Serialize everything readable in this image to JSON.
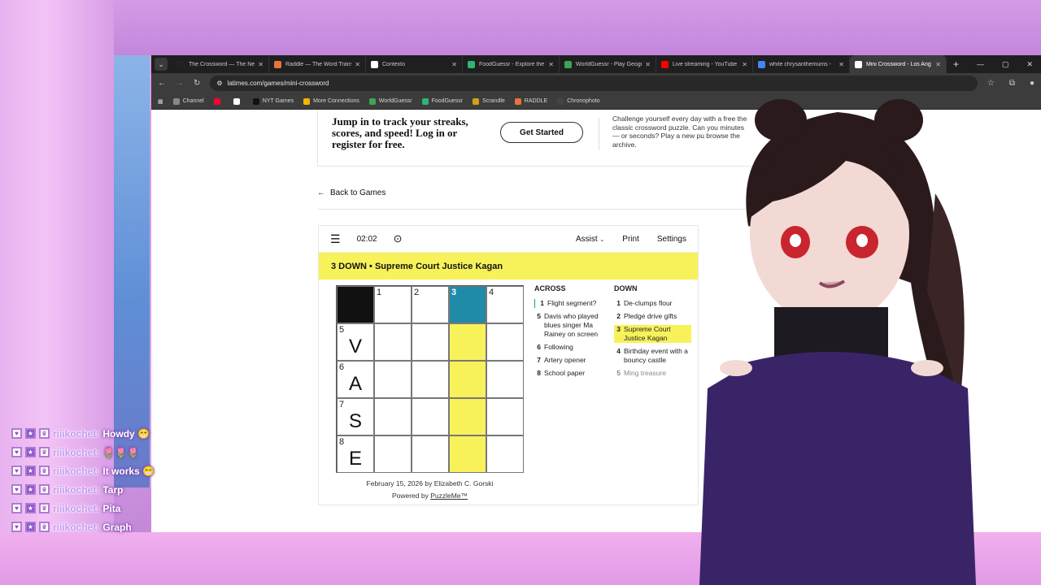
{
  "browser": {
    "tabs": [
      {
        "title": "The Crossword — The New",
        "color": "#222222",
        "active": false
      },
      {
        "title": "Raddle — The Word Trans",
        "color": "#e8743b",
        "active": false
      },
      {
        "title": "Contexto",
        "color": "#ffffff",
        "active": false
      },
      {
        "title": "FoodGuessr - Explore the",
        "color": "#2bb673",
        "active": false
      },
      {
        "title": "WorldGuessr - Play Geogr",
        "color": "#3aa655",
        "active": false
      },
      {
        "title": "Live streaming - YouTube",
        "color": "#ff0000",
        "active": false
      },
      {
        "title": "white chrysanthemums -",
        "color": "#4285f4",
        "active": false
      },
      {
        "title": "Mini Crossword - Los Ang",
        "color": "#ffffff",
        "active": true
      }
    ],
    "url": "latimes.com/games/mini-crossword",
    "bookmarks": [
      {
        "label": "Channel",
        "color": "#888888"
      },
      {
        "label": "",
        "color": "#ff0033"
      },
      {
        "label": "",
        "color": "#ffffff"
      },
      {
        "label": "NYT Games",
        "color": "#111111"
      },
      {
        "label": "More Connections",
        "color": "#f4b400"
      },
      {
        "label": "WorldGuessr",
        "color": "#3aa655"
      },
      {
        "label": "FoodGuessr",
        "color": "#2bb673"
      },
      {
        "label": "Scrandle",
        "color": "#d4a017"
      },
      {
        "label": "RADDLE",
        "color": "#e8743b"
      },
      {
        "label": "Chronophoto",
        "color": "#444444"
      }
    ]
  },
  "promo": {
    "headline": "Jump in to track your streaks, scores, and speed! Log in or register for free.",
    "button": "Get Started",
    "side_text": "Challenge yourself every day with a free the classic crossword puzzle. Can you minutes — or seconds? Play a new pu browse the archive."
  },
  "back_link": "Back to Games",
  "puzzle": {
    "timer": "02:02",
    "assist_label": "Assist",
    "print_label": "Print",
    "settings_label": "Settings",
    "current_clue": "3 DOWN  •  Supreme Court Justice Kagan",
    "grid": [
      [
        {
          "n": "",
          "l": "",
          "s": "black"
        },
        {
          "n": "1",
          "l": "",
          "s": ""
        },
        {
          "n": "2",
          "l": "",
          "s": ""
        },
        {
          "n": "3",
          "l": "",
          "s": "active"
        },
        {
          "n": "4",
          "l": "",
          "s": ""
        }
      ],
      [
        {
          "n": "5",
          "l": "V",
          "s": ""
        },
        {
          "n": "",
          "l": "",
          "s": ""
        },
        {
          "n": "",
          "l": "",
          "s": ""
        },
        {
          "n": "",
          "l": "",
          "s": "hl"
        },
        {
          "n": "",
          "l": "",
          "s": ""
        }
      ],
      [
        {
          "n": "6",
          "l": "A",
          "s": ""
        },
        {
          "n": "",
          "l": "",
          "s": ""
        },
        {
          "n": "",
          "l": "",
          "s": ""
        },
        {
          "n": "",
          "l": "",
          "s": "hl"
        },
        {
          "n": "",
          "l": "",
          "s": ""
        }
      ],
      [
        {
          "n": "7",
          "l": "S",
          "s": ""
        },
        {
          "n": "",
          "l": "",
          "s": ""
        },
        {
          "n": "",
          "l": "",
          "s": ""
        },
        {
          "n": "",
          "l": "",
          "s": "hl"
        },
        {
          "n": "",
          "l": "",
          "s": ""
        }
      ],
      [
        {
          "n": "8",
          "l": "E",
          "s": ""
        },
        {
          "n": "",
          "l": "",
          "s": ""
        },
        {
          "n": "",
          "l": "",
          "s": ""
        },
        {
          "n": "",
          "l": "",
          "s": "hl"
        },
        {
          "n": "",
          "l": "",
          "s": ""
        }
      ]
    ],
    "across_title": "ACROSS",
    "down_title": "DOWN",
    "across": [
      {
        "n": "1",
        "text": "Flight segment?",
        "state": "cur"
      },
      {
        "n": "5",
        "text": "Davis who played blues singer Ma Rainey on screen",
        "state": ""
      },
      {
        "n": "6",
        "text": "Following",
        "state": ""
      },
      {
        "n": "7",
        "text": "Artery opener",
        "state": ""
      },
      {
        "n": "8",
        "text": "School paper",
        "state": ""
      }
    ],
    "down": [
      {
        "n": "1",
        "text": "De-clumps flour",
        "state": ""
      },
      {
        "n": "2",
        "text": "Pledge drive gifts",
        "state": ""
      },
      {
        "n": "3",
        "text": "Supreme Court Justice Kagan",
        "state": "sel"
      },
      {
        "n": "4",
        "text": "Birthday event with a bouncy castle",
        "state": ""
      },
      {
        "n": "5",
        "text": "Ming treasure",
        "state": "done"
      }
    ],
    "byline": "February 15, 2026 by Elizabeth C. Gorski",
    "powered_prefix": "Powered by",
    "powered_link": "PuzzleMe™"
  },
  "chat": [
    {
      "user": "riiikochet:",
      "msg": "Howdy 😁"
    },
    {
      "user": "riiikochet:",
      "msg": "🌷🌷🌷"
    },
    {
      "user": "riiikochet:",
      "msg": "It works 😁"
    },
    {
      "user": "riiikochet:",
      "msg": "Tarp"
    },
    {
      "user": "riiikochet:",
      "msg": "Pita"
    },
    {
      "user": "riiikochet:",
      "msg": "Graph"
    }
  ],
  "colors": {
    "highlight": "#f8f25a",
    "active_cell": "#1f8ba8",
    "chat_user": "#c59bf0"
  }
}
